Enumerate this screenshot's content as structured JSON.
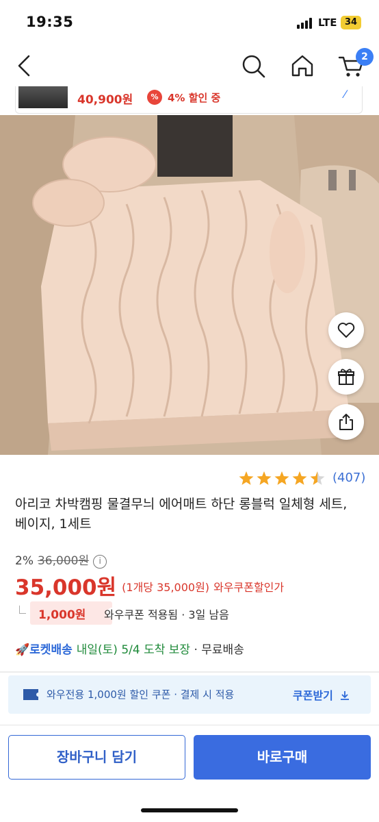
{
  "status": {
    "time": "19:35",
    "network": "LTE",
    "battery": "34"
  },
  "nav": {
    "cart_count": "2"
  },
  "price_strip": {
    "price": "40,900원",
    "discount_icon": "%",
    "discount": "4% 할인 중"
  },
  "floating_actions": [
    "heart-icon",
    "gift-icon",
    "share-icon"
  ],
  "rating": {
    "stars": 4.5,
    "count": "(407)"
  },
  "product": {
    "title": "아리코 차박캠핑 물결무늬 에어매트 하단 롱블럭 일체형 세트, 베이지, 1세트"
  },
  "pricing": {
    "discount_rate": "2%",
    "original_price": "36,000원",
    "sale_price": "35,000원",
    "unit_price": "(1개당 35,000원)",
    "coupon_tag": "와우쿠폰할인가"
  },
  "coupon": {
    "amount": "1,000원",
    "desc": "와우쿠폰 적용됨 · 3일 남음"
  },
  "delivery": {
    "rocket_icon": "🚀",
    "label": "로켓배송",
    "date": "내일(토) 5/4 도착 보장",
    "free": " · 무료배송"
  },
  "wow_banner": {
    "text": "와우전용 1,000원 할인 쿠폰 · 결제 시 적용",
    "link": "쿠폰받기"
  },
  "actions": {
    "cart_label": "장바구니 담기",
    "buy_label": "바로구매"
  },
  "colors": {
    "accent": "#3a6ce0",
    "price_red": "#d9362b",
    "star": "#f5a623"
  }
}
